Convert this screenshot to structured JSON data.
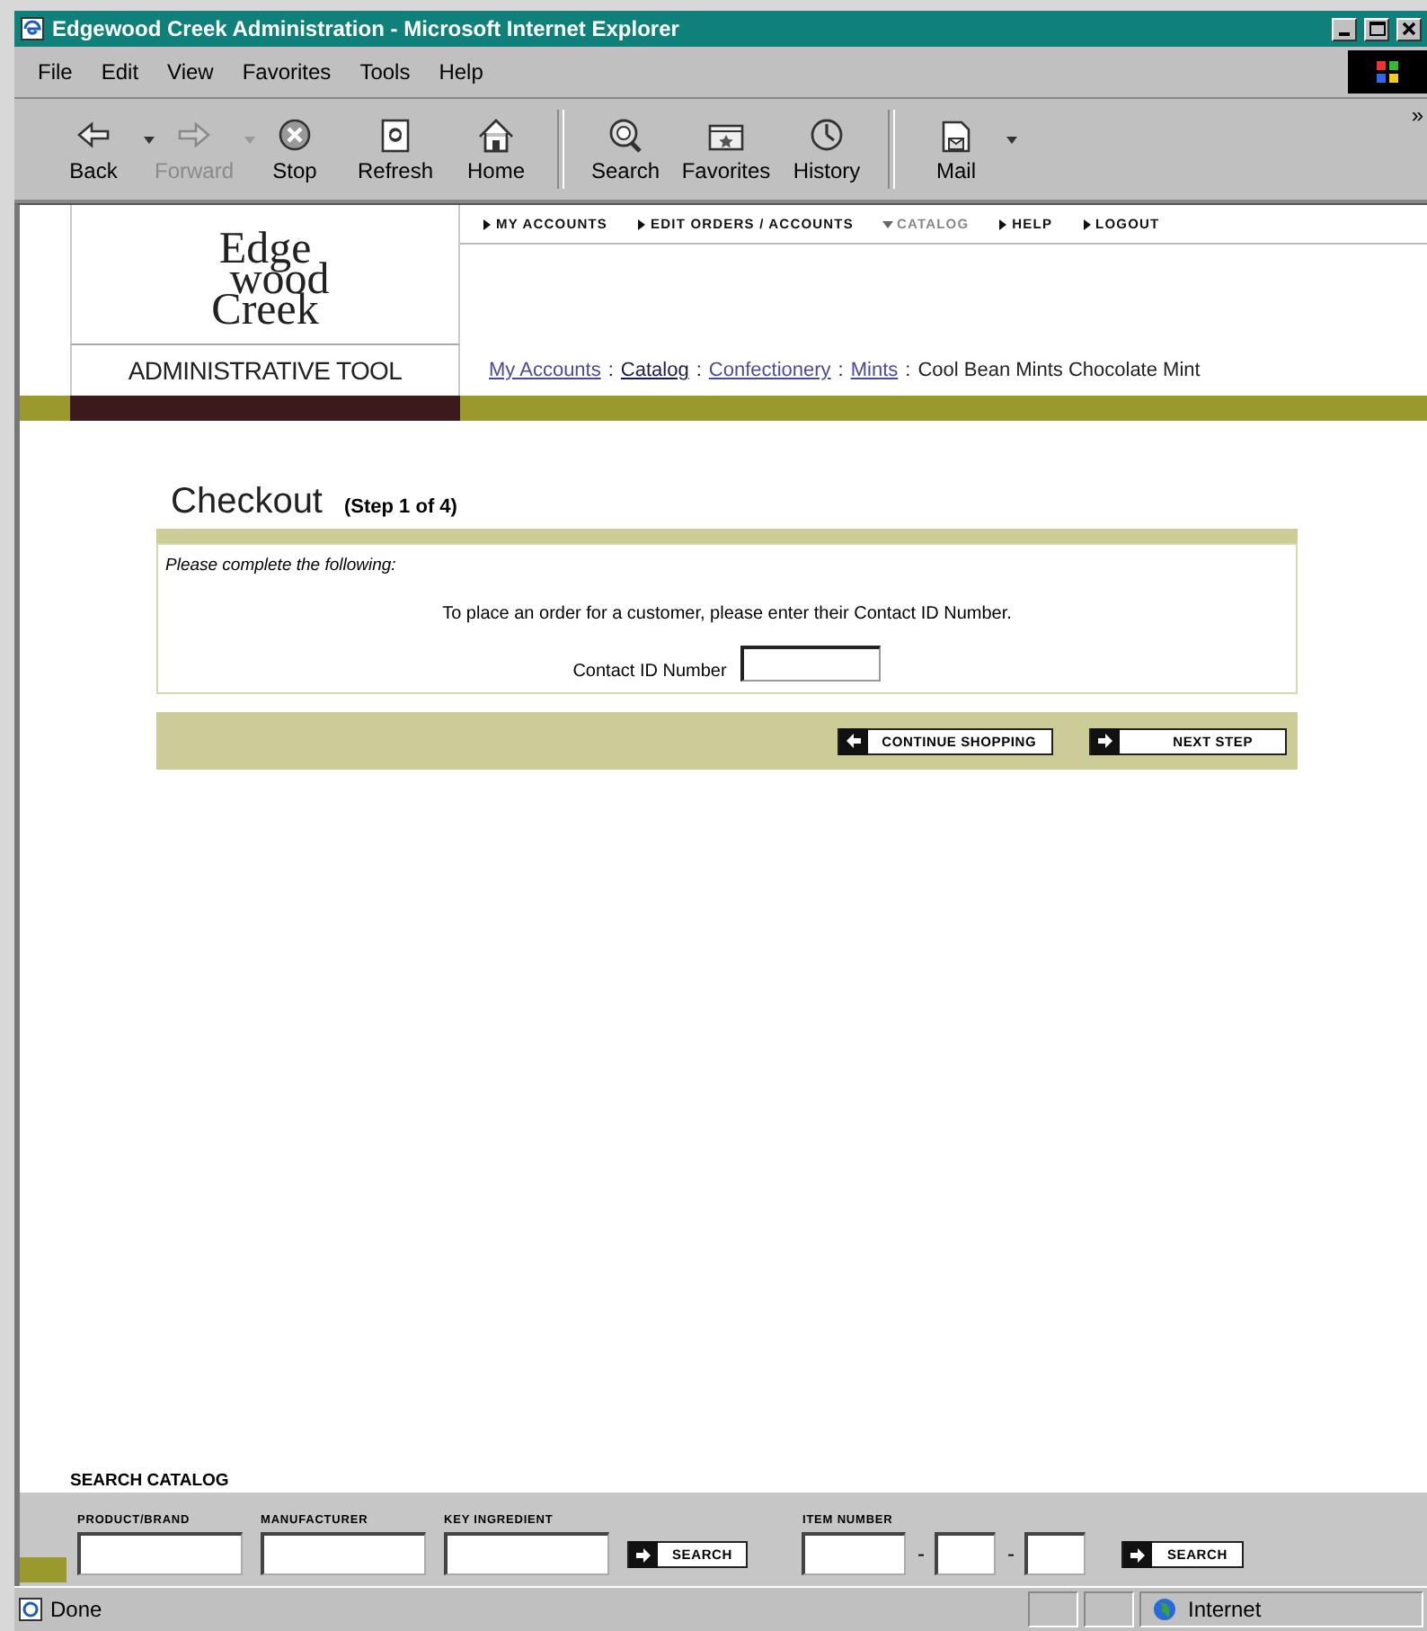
{
  "window": {
    "title": "Edgewood Creek Administration - Microsoft Internet Explorer"
  },
  "menu": [
    "File",
    "Edit",
    "View",
    "Favorites",
    "Tools",
    "Help"
  ],
  "toolbar": [
    {
      "kind": "back",
      "label": "Back",
      "disabled": false,
      "dropdown": true
    },
    {
      "kind": "forward",
      "label": "Forward",
      "disabled": true,
      "dropdown": true
    },
    {
      "kind": "stop",
      "label": "Stop",
      "disabled": false,
      "dropdown": false
    },
    {
      "kind": "refresh",
      "label": "Refresh",
      "disabled": false,
      "dropdown": false
    },
    {
      "kind": "home",
      "label": "Home",
      "disabled": false,
      "dropdown": false
    },
    {
      "kind": "search",
      "label": "Search",
      "disabled": false,
      "dropdown": false
    },
    {
      "kind": "favorites",
      "label": "Favorites",
      "disabled": false,
      "dropdown": false
    },
    {
      "kind": "history",
      "label": "History",
      "disabled": false,
      "dropdown": false
    },
    {
      "kind": "mail",
      "label": "Mail",
      "disabled": false,
      "dropdown": true
    }
  ],
  "toolbar_overflow": "»",
  "logo": [
    "Edge",
    "wood",
    "Creek"
  ],
  "tagline": "ADMINISTRATIVE TOOL",
  "nav": [
    {
      "label": "MY ACCOUNTS",
      "selected": false
    },
    {
      "label": "EDIT ORDERS / ACCOUNTS",
      "selected": false
    },
    {
      "label": "CATALOG",
      "selected": true
    },
    {
      "label": "HELP",
      "selected": false
    },
    {
      "label": "LOGOUT",
      "selected": false
    }
  ],
  "breadcrumb": [
    {
      "kind": "link",
      "label": "My Accounts"
    },
    {
      "kind": "separator",
      "label": ":"
    },
    {
      "kind": "visited",
      "label": "Catalog"
    },
    {
      "kind": "separator",
      "label": ":"
    },
    {
      "kind": "link",
      "label": "Confectionery"
    },
    {
      "kind": "separator",
      "label": ":"
    },
    {
      "kind": "link",
      "label": "Mints"
    },
    {
      "kind": "separator",
      "label": ":"
    },
    {
      "kind": "current",
      "label": "Cool Bean Mints Chocolate Mint"
    }
  ],
  "checkout": {
    "title": "Checkout",
    "step": "(Step 1 of 4)",
    "prompt": "Please complete the following:",
    "instruction": "To place an order for a customer, please enter their Contact ID Number.",
    "field_label": "Contact ID Number",
    "buttons": [
      {
        "kind": "back",
        "label": "CONTINUE SHOPPING"
      },
      {
        "kind": "next",
        "label": "NEXT STEP"
      }
    ]
  },
  "search": {
    "title": "SEARCH CATALOG",
    "fields": [
      {
        "label": "PRODUCT/BRAND"
      },
      {
        "label": "MANUFACTURER"
      },
      {
        "label": "KEY INGREDIENT"
      }
    ],
    "button": "SEARCH",
    "item_number": {
      "label": "ITEM NUMBER",
      "separators": [
        "-",
        "-"
      ]
    },
    "item_button": "SEARCH"
  },
  "status_bar": {
    "text": "Done",
    "zone": "Internet"
  }
}
